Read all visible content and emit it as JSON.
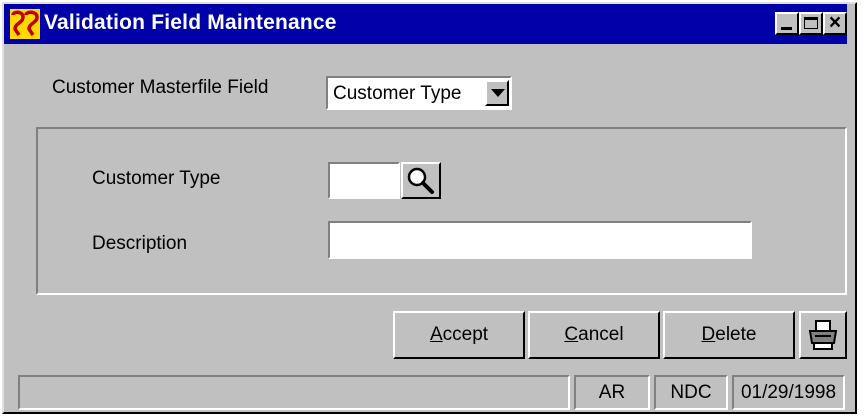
{
  "window": {
    "title": "Validation Field Maintenance",
    "icon": "app-logo-icon",
    "controls": {
      "minimize_icon": "minimize-icon",
      "maximize_icon": "maximize-icon",
      "close_glyph": "×"
    }
  },
  "masterfile": {
    "label": "Customer Masterfile Field",
    "selected": "Customer Type"
  },
  "form": {
    "customer_type_label": "Customer Type",
    "customer_type_value": "",
    "description_label": "Description",
    "description_value": ""
  },
  "buttons": {
    "accept_mnemonic": "A",
    "accept_rest": "ccept",
    "cancel_mnemonic": "C",
    "cancel_rest": "ancel",
    "delete_mnemonic": "D",
    "delete_rest": "elete",
    "print_icon": "printer-icon",
    "lookup_icon": "magnifier-icon"
  },
  "status": {
    "message": "",
    "module": "AR",
    "company": "NDC",
    "date": "01/29/1998"
  },
  "colors": {
    "titlebar": "#0000a8",
    "face": "#c0c0c0",
    "logo_red": "#c00000",
    "logo_yellow": "#ffd800"
  }
}
